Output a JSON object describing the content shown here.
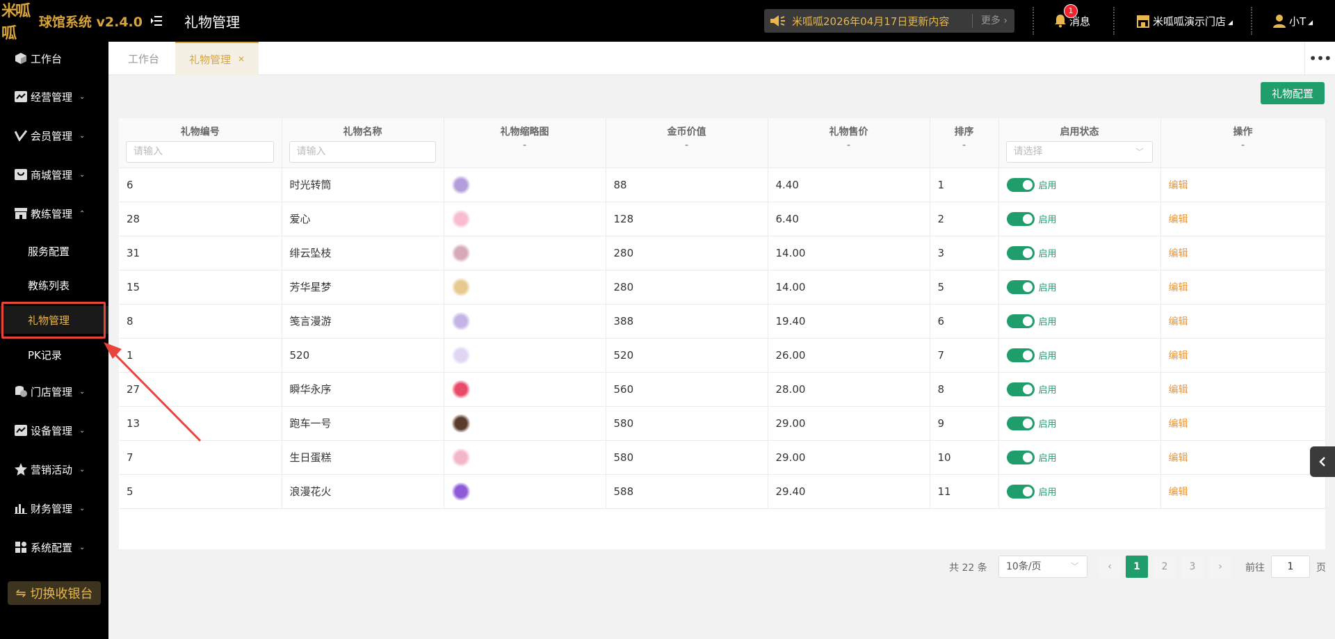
{
  "app": {
    "logo_mark": "米呱呱",
    "name": "球馆系统 v2.4.0",
    "page_title": "礼物管理"
  },
  "header": {
    "notice_text": "米呱呱2026年04月17日更新内容",
    "notice_more": "更多",
    "messages_label": "消息",
    "messages_badge": "1",
    "store_name": "米呱呱演示门店",
    "user_name": "小T"
  },
  "sidebar": {
    "items": [
      {
        "label": "工作台"
      },
      {
        "label": "经营管理"
      },
      {
        "label": "会员管理"
      },
      {
        "label": "商城管理"
      },
      {
        "label": "教练管理"
      },
      {
        "label": "门店管理"
      },
      {
        "label": "设备管理"
      },
      {
        "label": "营销活动"
      },
      {
        "label": "财务管理"
      },
      {
        "label": "系统配置"
      }
    ],
    "sub_items": [
      {
        "label": "服务配置"
      },
      {
        "label": "教练列表"
      },
      {
        "label": "礼物管理"
      },
      {
        "label": "PK记录"
      }
    ],
    "switch_label": "切换收银台"
  },
  "tabs": [
    {
      "label": "工作台"
    },
    {
      "label": "礼物管理"
    }
  ],
  "toolbar": {
    "config_label": "礼物配置"
  },
  "table": {
    "headers": {
      "id": "礼物编号",
      "name": "礼物名称",
      "thumb": "礼物缩略图",
      "coin": "金币价值",
      "price": "礼物售价",
      "sort": "排序",
      "status": "启用状态",
      "ops": "操作"
    },
    "header_dash": "-",
    "input_placeholder": "请输入",
    "select_placeholder": "请选择",
    "status_label": "启用",
    "edit_label": "编辑",
    "rows": [
      {
        "id": "6",
        "name": "时光转筒",
        "coin": "88",
        "price": "4.40",
        "sort": "1",
        "color": "#b39ddb"
      },
      {
        "id": "28",
        "name": "爱心",
        "coin": "128",
        "price": "6.40",
        "sort": "2",
        "color": "#f8bbd0"
      },
      {
        "id": "31",
        "name": "绯云坠枝",
        "coin": "280",
        "price": "14.00",
        "sort": "3",
        "color": "#d7a9b8"
      },
      {
        "id": "15",
        "name": "芳华星梦",
        "coin": "280",
        "price": "14.00",
        "sort": "5",
        "color": "#e6c98f"
      },
      {
        "id": "8",
        "name": "笺言漫游",
        "coin": "388",
        "price": "19.40",
        "sort": "6",
        "color": "#c5b3e6"
      },
      {
        "id": "1",
        "name": "520",
        "coin": "520",
        "price": "26.00",
        "sort": "7",
        "color": "#e1d5f5"
      },
      {
        "id": "27",
        "name": "瞬华永序",
        "coin": "560",
        "price": "28.00",
        "sort": "8",
        "color": "#e84a6a"
      },
      {
        "id": "13",
        "name": "跑车一号",
        "coin": "580",
        "price": "29.00",
        "sort": "9",
        "color": "#5a3a2a"
      },
      {
        "id": "7",
        "name": "生日蛋糕",
        "coin": "580",
        "price": "29.00",
        "sort": "10",
        "color": "#f3b6c8"
      },
      {
        "id": "5",
        "name": "浪漫花火",
        "coin": "588",
        "price": "29.40",
        "sort": "11",
        "color": "#8e5ad6"
      }
    ]
  },
  "pagination": {
    "total_text": "共 22 条",
    "page_size": "10条/页",
    "pages": [
      "1",
      "2",
      "3"
    ],
    "goto_label": "前往",
    "current": "1",
    "page_suffix": "页"
  },
  "colors": {
    "brand": "#d9a43a",
    "primary": "#1f9d6b",
    "link": "#e8973a",
    "highlight": "#e8443a"
  }
}
